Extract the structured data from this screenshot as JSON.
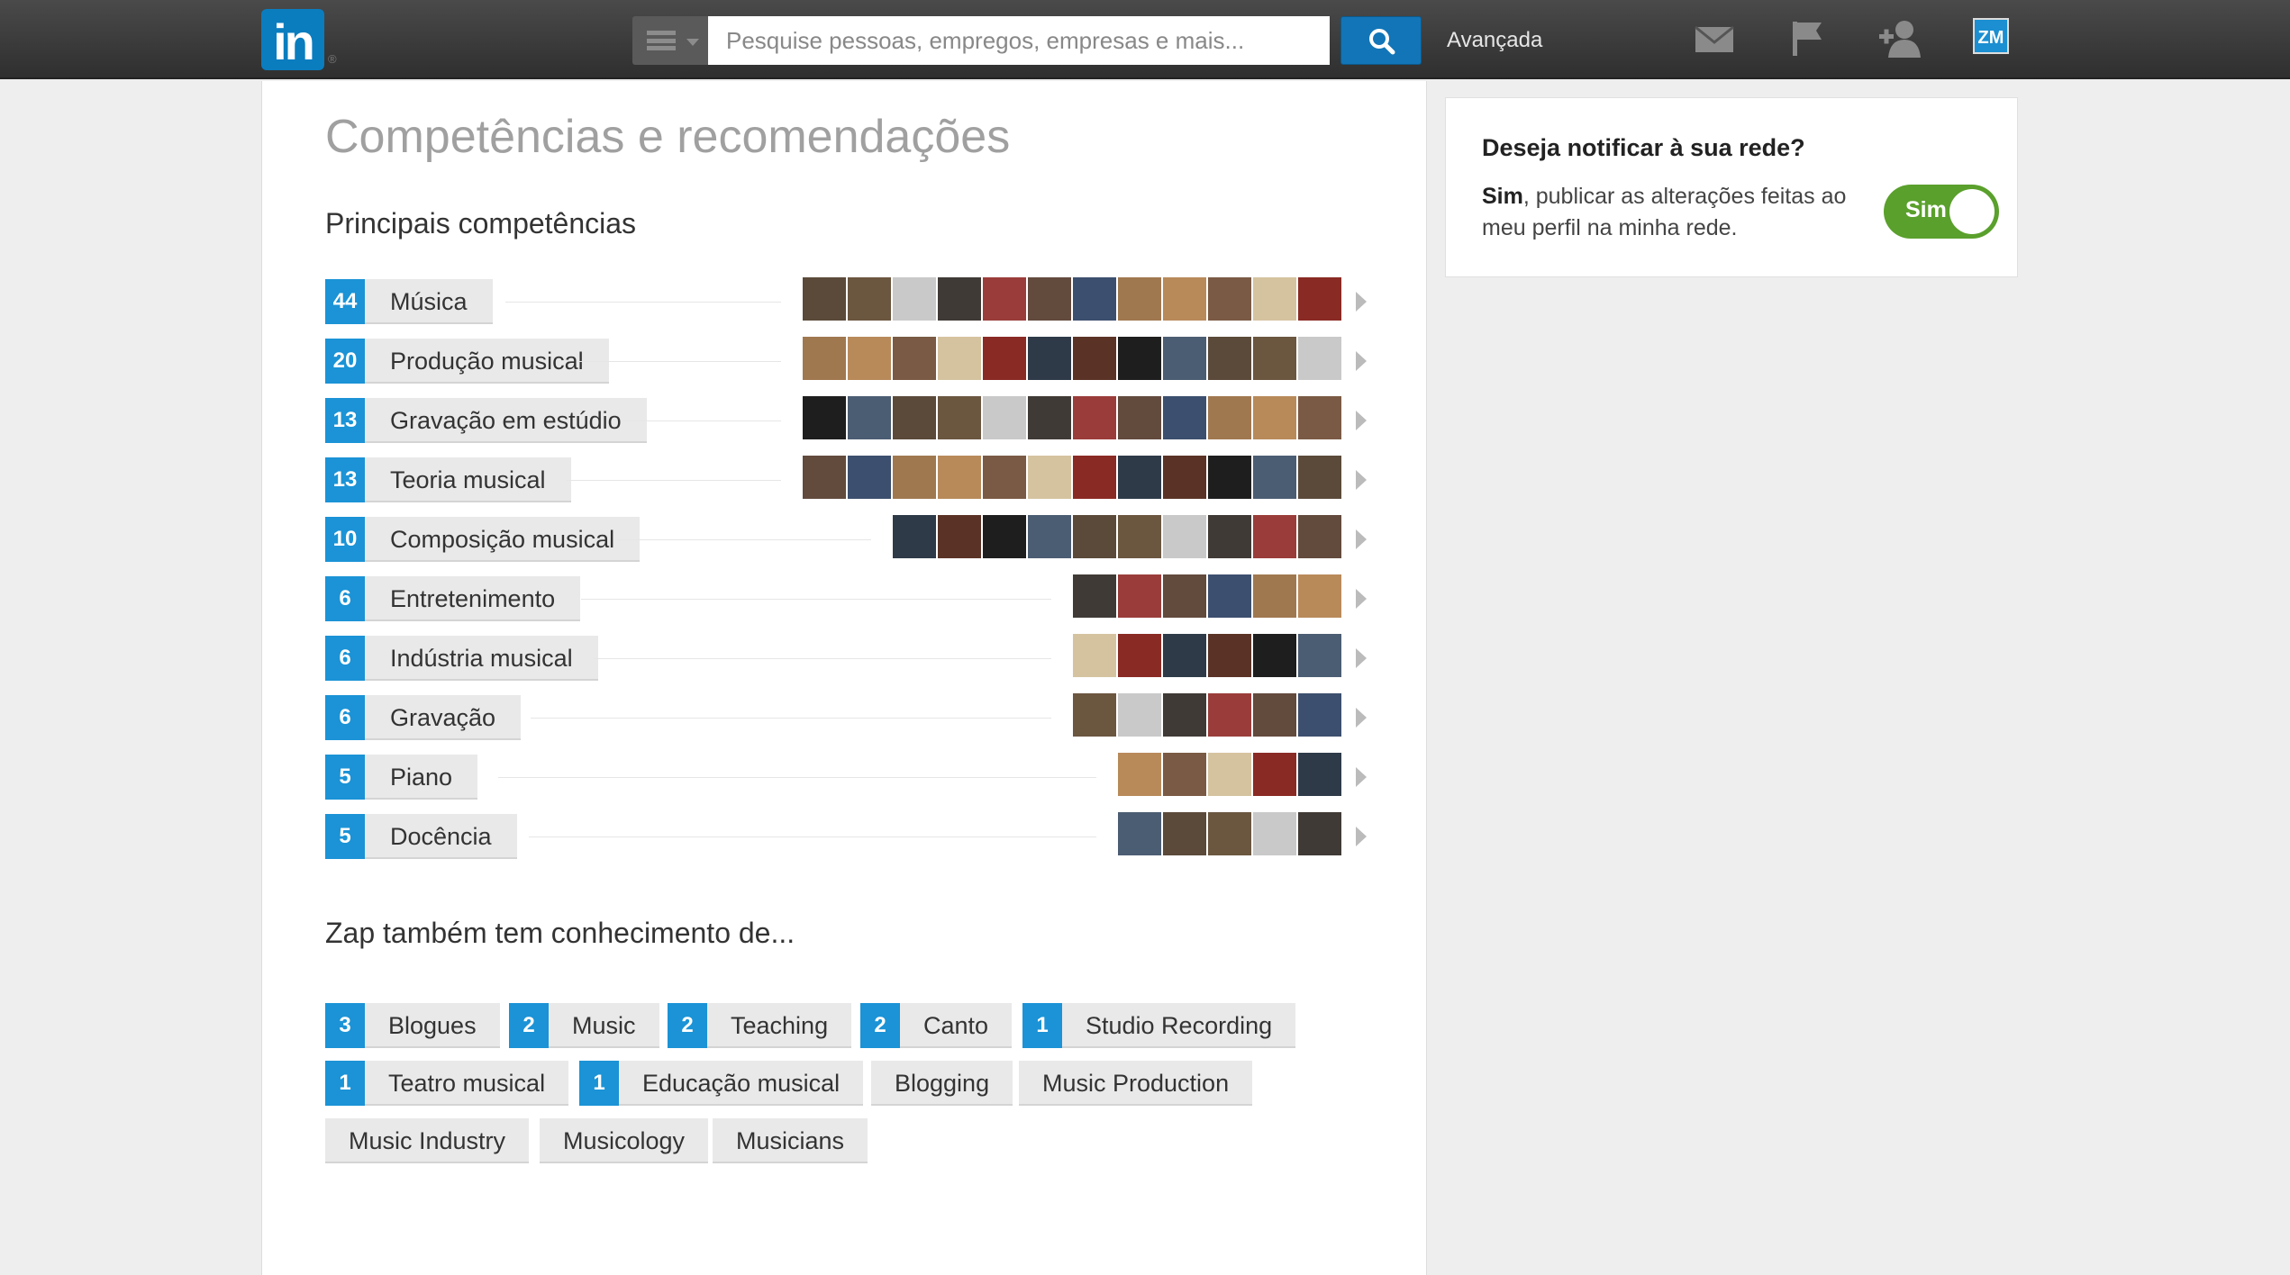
{
  "header": {
    "logo_text": "in",
    "logo_mark": "®",
    "search_placeholder": "Pesquise pessoas, empregos, empresas e mais...",
    "advanced_label": "Avançada",
    "icons": [
      "menu-icon",
      "search-icon",
      "messages-icon",
      "notifications-flag-icon",
      "add-connections-icon",
      "profile-avatar-icon"
    ],
    "avatar_initials": "ZM"
  },
  "main": {
    "title": "Competências e recomendações",
    "top_skills_title": "Principais competências",
    "top_skills": [
      {
        "count": "44",
        "name": "Música",
        "endorsers": 12
      },
      {
        "count": "20",
        "name": "Produção musical",
        "endorsers": 12
      },
      {
        "count": "13",
        "name": "Gravação em estúdio",
        "endorsers": 12
      },
      {
        "count": "13",
        "name": "Teoria musical",
        "endorsers": 12
      },
      {
        "count": "10",
        "name": "Composição musical",
        "endorsers": 10
      },
      {
        "count": "6",
        "name": "Entretenimento",
        "endorsers": 6
      },
      {
        "count": "6",
        "name": "Indústria musical",
        "endorsers": 6
      },
      {
        "count": "6",
        "name": "Gravação",
        "endorsers": 6
      },
      {
        "count": "5",
        "name": "Piano",
        "endorsers": 5
      },
      {
        "count": "5",
        "name": "Docência",
        "endorsers": 5
      }
    ],
    "also_title": "Zap também tem conhecimento de...",
    "other_skills": [
      {
        "count": "3",
        "name": "Blogues"
      },
      {
        "count": "2",
        "name": "Music"
      },
      {
        "count": "2",
        "name": "Teaching"
      },
      {
        "count": "2",
        "name": "Canto"
      },
      {
        "count": "1",
        "name": "Studio Recording"
      },
      {
        "count": "1",
        "name": "Teatro musical"
      },
      {
        "count": "1",
        "name": "Educação musical"
      },
      {
        "count": "",
        "name": "Blogging"
      },
      {
        "count": "",
        "name": "Music Production"
      },
      {
        "count": "",
        "name": "Music Industry"
      },
      {
        "count": "",
        "name": "Musicology"
      },
      {
        "count": "",
        "name": "Musicians"
      }
    ]
  },
  "sidebar": {
    "notify_title": "Deseja notificar à sua rede?",
    "notify_bold": "Sim",
    "notify_text": ", publicar as alterações feitas ao meu perfil na minha rede.",
    "toggle_label": "Sim",
    "toggle_on": true
  },
  "colors": {
    "accent": "#1b93d6",
    "toggle_on": "#5aa02c",
    "topbar": "#3a3a3a"
  }
}
